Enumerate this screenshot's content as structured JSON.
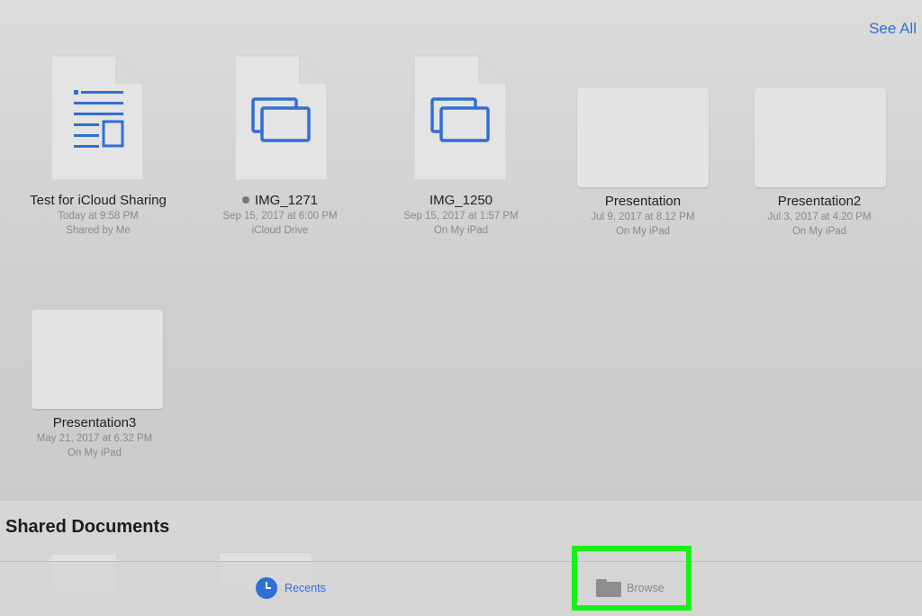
{
  "header": {
    "see_all_label": "See All"
  },
  "recents": [
    {
      "name": "Test for iCloud Sharing",
      "date": "Today at 9:58 PM",
      "location": "Shared by Me",
      "icon": "pages-document-icon"
    },
    {
      "name": "IMG_1271",
      "date": "Sep 15, 2017 at 6:00 PM",
      "location": "iCloud Drive",
      "icon": "keynote-document-icon"
    },
    {
      "name": "IMG_1250",
      "date": "Sep 15, 2017 at 1:57 PM",
      "location": "On My iPad",
      "icon": "keynote-document-icon"
    },
    {
      "name": "Presentation",
      "date": "Jul 9, 2017 at 8.12 PM",
      "location": "On My iPad"
    },
    {
      "name": "Presentation2",
      "date": "Jul  3, 2017 at 4.20 PM",
      "location": "On My iPad"
    },
    {
      "name": "Presentation3",
      "date": "May 21, 2017 at 6.32 PM",
      "location": "On My iPad"
    }
  ],
  "shared_section": {
    "title": "Shared Documents"
  },
  "tabbar": {
    "recents_label": "Recents",
    "browse_label": "Browse"
  },
  "colors": {
    "accent": "#2f6fd6",
    "highlight": "#19f019"
  }
}
